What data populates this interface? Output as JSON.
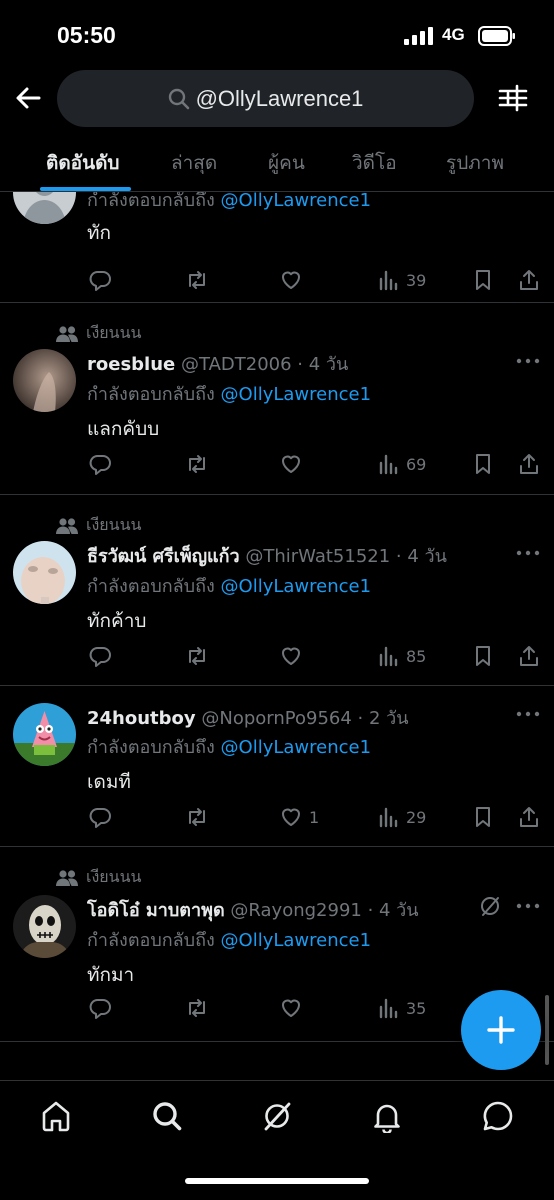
{
  "status_bar": {
    "time": "05:50",
    "network": "4G"
  },
  "search": {
    "query": "@OllyLawrence1"
  },
  "tabs": [
    {
      "label": "ติดอันดับ",
      "active": true
    },
    {
      "label": "ล่าสุด"
    },
    {
      "label": "ผู้คน"
    },
    {
      "label": "วิดีโอ"
    },
    {
      "label": "รูปภาพ"
    }
  ],
  "posts": [
    {
      "reply_prefix": "กำลังตอบกลับถึง",
      "mention": "@OllyLawrence1",
      "text": "ทัก",
      "views": "39"
    },
    {
      "social": "เงียนนน",
      "name": "roesblue",
      "meta": " @TADT2006 · 4 วัน",
      "reply_prefix": "กำลังตอบกลับถึง",
      "mention": "@OllyLawrence1",
      "text": "แลกคับบ",
      "views": "69"
    },
    {
      "social": "เงียนนน",
      "name": "ธีรวัฒน์ ศรีเพ็ญแก้ว",
      "meta": " @ThirWat51521 · 4 วัน",
      "reply_prefix": "กำลังตอบกลับถึง",
      "mention": "@OllyLawrence1",
      "text": "ทักค้าบ",
      "views": "85"
    },
    {
      "name": "24houtboy",
      "meta": " @NopornPo9564 · 2 วัน",
      "reply_prefix": "กำลังตอบกลับถึง",
      "mention": "@OllyLawrence1",
      "text": "เดมที",
      "likes": "1",
      "views": "29"
    },
    {
      "social": "เงียนนน",
      "name": "โอดิโอ๋ มาบตาพุด",
      "meta": " @Rayong2991 · 4 วัน",
      "reply_prefix": "กำลังตอบกลับถึง",
      "mention": "@OllyLawrence1",
      "text": "ทักมา",
      "views": "35"
    }
  ],
  "colors": {
    "accent": "#1d9bf0",
    "background": "#000000",
    "muted": "#71767b",
    "text": "#e7e9ea"
  },
  "icons": [
    "back-arrow-icon",
    "search-icon",
    "filter-sliders-icon",
    "reply-icon",
    "retweet-icon",
    "like-icon",
    "views-icon",
    "bookmark-icon",
    "share-icon",
    "more-icon",
    "grok-icon",
    "compose-plus-icon",
    "home-icon",
    "explore-icon",
    "grok-nav-icon",
    "notifications-icon",
    "messages-icon"
  ]
}
